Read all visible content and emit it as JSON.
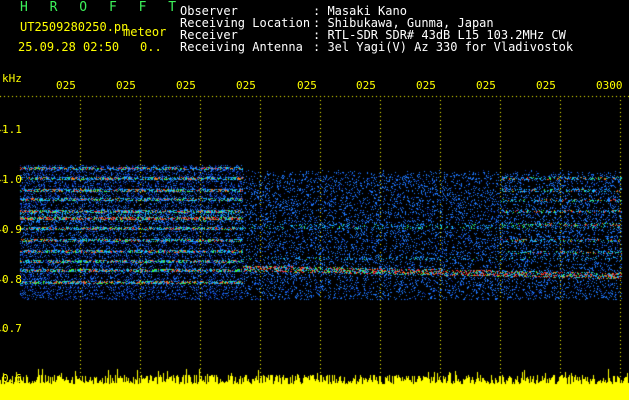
{
  "header": {
    "app_name": "H R O F F T",
    "filename": "UT2509280250.pn",
    "mode": "meteor",
    "datetime": "25.09.28 02:50",
    "counter": "0..",
    "labels": {
      "observer": "Observer",
      "location": "Receiving Location",
      "receiver": "Receiver",
      "antenna": "Receiving Antenna"
    },
    "values": {
      "observer": ": Masaki Kano",
      "location": ": Shibukawa, Gunma, Japan",
      "receiver": ": RTL-SDR SDR# 43dB L15 103.2MHz CW",
      "antenna": ": 3el Yagi(V) Az 330 for Vladivostok"
    }
  },
  "spectrogram": {
    "y_unit": "kHz",
    "y_ticks": [
      "1.1",
      "1.0",
      "0.9",
      "0.8",
      "0.7",
      "0.6"
    ],
    "x_ticks": [
      "025",
      "025",
      "025",
      "025",
      "025",
      "025",
      "025",
      "025",
      "025",
      "0300"
    ],
    "colors": {
      "background": "#000000",
      "label": "#ffff00",
      "header_text": "#ffffff",
      "app_name": "#3df25a"
    }
  }
}
